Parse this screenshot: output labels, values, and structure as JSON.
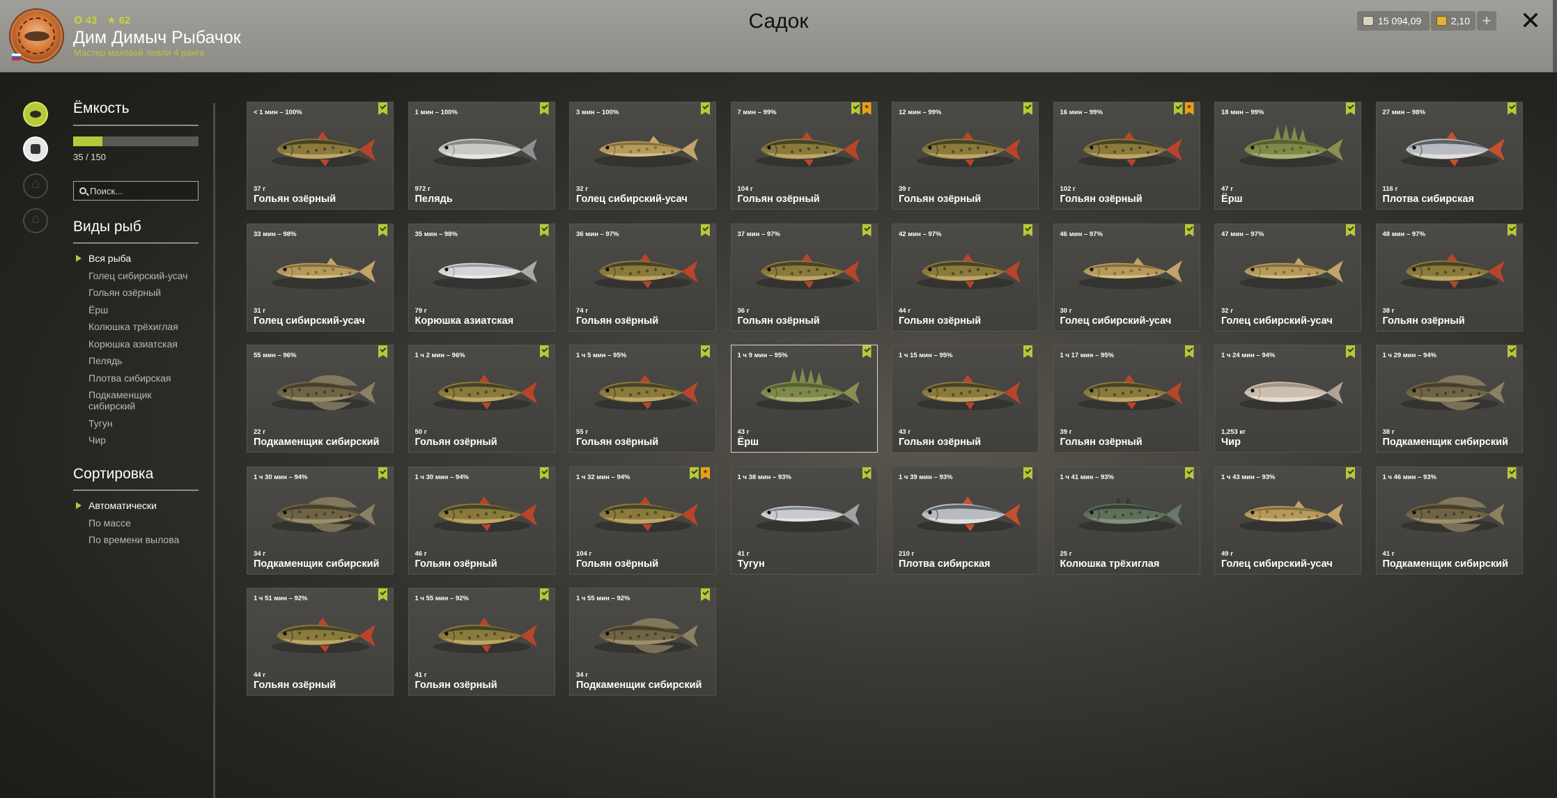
{
  "header": {
    "title": "Садок",
    "player": {
      "level": "43",
      "rating": "62",
      "name": "Дим Димыч Рыбачок",
      "rank": "Мастер маховой ловли 4 ранга"
    },
    "silver": "15 094,09",
    "gold": "2,10",
    "plus_label": "+",
    "close_label": "✕"
  },
  "sidebar": {
    "capacity_title": "Ёмкость",
    "capacity_text": "35 / 150",
    "capacity_fraction": 0.2333,
    "search_placeholder": "Поиск...",
    "species_title": "Виды рыб",
    "species": [
      {
        "label": "Вся рыба",
        "active": true
      },
      {
        "label": "Голец сибирский-усач"
      },
      {
        "label": "Гольян озёрный"
      },
      {
        "label": "Ёрш"
      },
      {
        "label": "Колюшка трёхиглая"
      },
      {
        "label": "Корюшка азиатская"
      },
      {
        "label": "Пелядь"
      },
      {
        "label": "Плотва сибирская"
      },
      {
        "label": "Подкаменщик сибирский"
      },
      {
        "label": "Тугун"
      },
      {
        "label": "Чир"
      }
    ],
    "sort_title": "Сортировка",
    "sort": [
      {
        "label": "Автоматически",
        "active": true
      },
      {
        "label": "По массе"
      },
      {
        "label": "По времени вылова"
      }
    ]
  },
  "fish": [
    {
      "time": "< 1 мин – 100%",
      "weight": "37 г",
      "name": "Гольян озёрный",
      "kind": "minnow",
      "star": false
    },
    {
      "time": "1 мин – 100%",
      "weight": "972 г",
      "name": "Пелядь",
      "kind": "peled",
      "star": false
    },
    {
      "time": "3 мин – 100%",
      "weight": "32 г",
      "name": "Голец сибирский-усач",
      "kind": "loach",
      "star": false
    },
    {
      "time": "7 мин – 99%",
      "weight": "104 г",
      "name": "Гольян озёрный",
      "kind": "minnow",
      "star": true
    },
    {
      "time": "12 мин – 99%",
      "weight": "39 г",
      "name": "Гольян озёрный",
      "kind": "minnow",
      "star": false
    },
    {
      "time": "16 мин – 99%",
      "weight": "102 г",
      "name": "Гольян озёрный",
      "kind": "minnow",
      "star": true
    },
    {
      "time": "18 мин – 99%",
      "weight": "47 г",
      "name": "Ёрш",
      "kind": "ruffe",
      "star": false
    },
    {
      "time": "27 мин – 98%",
      "weight": "116 г",
      "name": "Плотва сибирская",
      "kind": "roach",
      "star": false
    },
    {
      "time": "33 мин – 98%",
      "weight": "31 г",
      "name": "Голец сибирский-усач",
      "kind": "loach",
      "star": false
    },
    {
      "time": "35 мин – 98%",
      "weight": "79 г",
      "name": "Корюшка азиатская",
      "kind": "smelt",
      "star": false
    },
    {
      "time": "36 мин – 97%",
      "weight": "74 г",
      "name": "Гольян озёрный",
      "kind": "minnow",
      "star": false
    },
    {
      "time": "37 мин – 97%",
      "weight": "36 г",
      "name": "Гольян озёрный",
      "kind": "minnow",
      "star": false
    },
    {
      "time": "42 мин – 97%",
      "weight": "44 г",
      "name": "Гольян озёрный",
      "kind": "minnow",
      "star": false
    },
    {
      "time": "46 мин – 97%",
      "weight": "30 г",
      "name": "Голец сибирский-усач",
      "kind": "loach",
      "star": false
    },
    {
      "time": "47 мин – 97%",
      "weight": "32 г",
      "name": "Голец сибирский-усач",
      "kind": "loach",
      "star": false
    },
    {
      "time": "48 мин – 97%",
      "weight": "38 г",
      "name": "Гольян озёрный",
      "kind": "minnow",
      "star": false
    },
    {
      "time": "55 мин – 96%",
      "weight": "22 г",
      "name": "Подкаменщик сибирский",
      "kind": "sculpin",
      "star": false
    },
    {
      "time": "1 ч 2 мин – 96%",
      "weight": "50 г",
      "name": "Гольян озёрный",
      "kind": "minnow",
      "star": false
    },
    {
      "time": "1 ч 5 мин – 95%",
      "weight": "55 г",
      "name": "Гольян озёрный",
      "kind": "minnow",
      "star": false
    },
    {
      "time": "1 ч 9 мин – 95%",
      "weight": "43 г",
      "name": "Ёрш",
      "kind": "ruffe",
      "star": false,
      "selected": true
    },
    {
      "time": "1 ч 15 мин – 95%",
      "weight": "43 г",
      "name": "Гольян озёрный",
      "kind": "minnow",
      "star": false
    },
    {
      "time": "1 ч 17 мин – 95%",
      "weight": "39 г",
      "name": "Гольян озёрный",
      "kind": "minnow",
      "star": false
    },
    {
      "time": "1 ч 24 мин – 94%",
      "weight": "1,253 кг",
      "name": "Чир",
      "kind": "chir",
      "star": false
    },
    {
      "time": "1 ч 29 мин – 94%",
      "weight": "38 г",
      "name": "Подкаменщик сибирский",
      "kind": "sculpin",
      "star": false
    },
    {
      "time": "1 ч 30 мин – 94%",
      "weight": "34 г",
      "name": "Подкаменщик сибирский",
      "kind": "sculpin",
      "star": false
    },
    {
      "time": "1 ч 30 мин – 94%",
      "weight": "46 г",
      "name": "Гольян озёрный",
      "kind": "minnow",
      "star": false
    },
    {
      "time": "1 ч 32 мин – 94%",
      "weight": "104 г",
      "name": "Гольян озёрный",
      "kind": "minnow",
      "star": true
    },
    {
      "time": "1 ч 38 мин – 93%",
      "weight": "41 г",
      "name": "Тугун",
      "kind": "tugun",
      "star": false
    },
    {
      "time": "1 ч 39 мин – 93%",
      "weight": "210 г",
      "name": "Плотва сибирская",
      "kind": "roach",
      "star": false
    },
    {
      "time": "1 ч 41 мин – 93%",
      "weight": "25 г",
      "name": "Колюшка трёхиглая",
      "kind": "stickleback",
      "star": false
    },
    {
      "time": "1 ч 43 мин – 93%",
      "weight": "49 г",
      "name": "Голец сибирский-усач",
      "kind": "loach",
      "star": false
    },
    {
      "time": "1 ч 46 мин – 93%",
      "weight": "41 г",
      "name": "Подкаменщик сибирский",
      "kind": "sculpin",
      "star": false
    },
    {
      "time": "1 ч 51 мин – 92%",
      "weight": "44 г",
      "name": "Гольян озёрный",
      "kind": "minnow",
      "star": false
    },
    {
      "time": "1 ч 55 мин – 92%",
      "weight": "41 г",
      "name": "Гольян озёрный",
      "kind": "minnow",
      "star": false
    },
    {
      "time": "1 ч 55 мин – 92%",
      "weight": "34 г",
      "name": "Подкаменщик сибирский",
      "kind": "sculpin",
      "star": false
    }
  ],
  "colors": {
    "accent": "#b6c93a",
    "star": "#e8a21a"
  }
}
